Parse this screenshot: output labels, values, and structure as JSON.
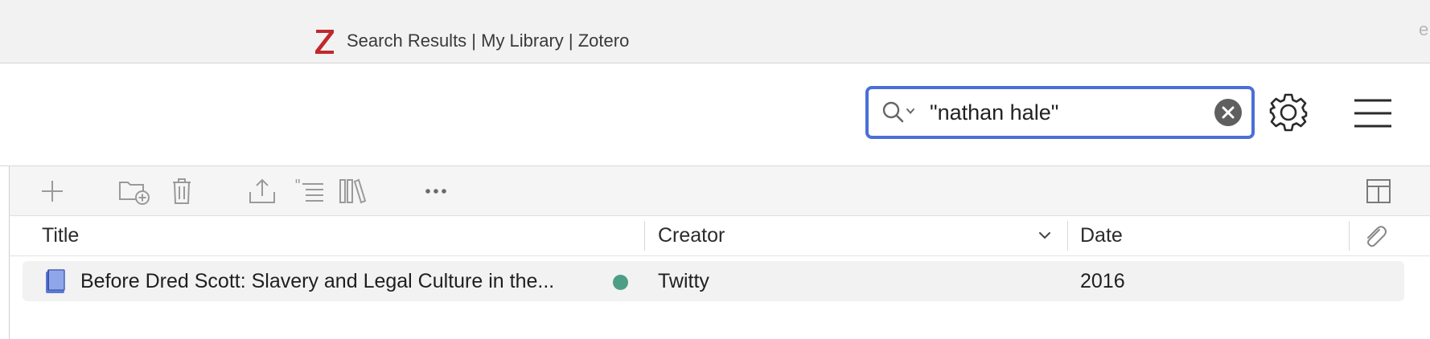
{
  "window": {
    "title": "Search Results | My Library | Zotero",
    "app_icon": "zotero-logo",
    "edge_letter": "e"
  },
  "search": {
    "value": "\"nathan hale\"",
    "placeholder": "",
    "border_color": "#4a6fd8"
  },
  "toolbar": {
    "icons": [
      "search-icon",
      "chevron-down-icon",
      "clear-icon",
      "gear-icon",
      "hamburger-menu-icon"
    ]
  },
  "items_toolbar": {
    "icons": [
      "plus-icon",
      "new-collection-icon",
      "trash-icon",
      "export-icon",
      "citation-icon",
      "library-icon",
      "more-icon",
      "column-picker-icon"
    ]
  },
  "columns": {
    "title": "Title",
    "creator": "Creator",
    "date": "Date",
    "attachment_icon": "paperclip-icon"
  },
  "items": [
    {
      "icon": "book-icon",
      "title": "Before Dred Scott: Slavery and Legal Culture in the...",
      "status_color": "#4e9e86",
      "creator": "Twitty",
      "date": "2016"
    }
  ],
  "colors": {
    "accent": "#4a6fd8",
    "logo_red": "#c0282d",
    "book_blue": "#5a78d4"
  }
}
